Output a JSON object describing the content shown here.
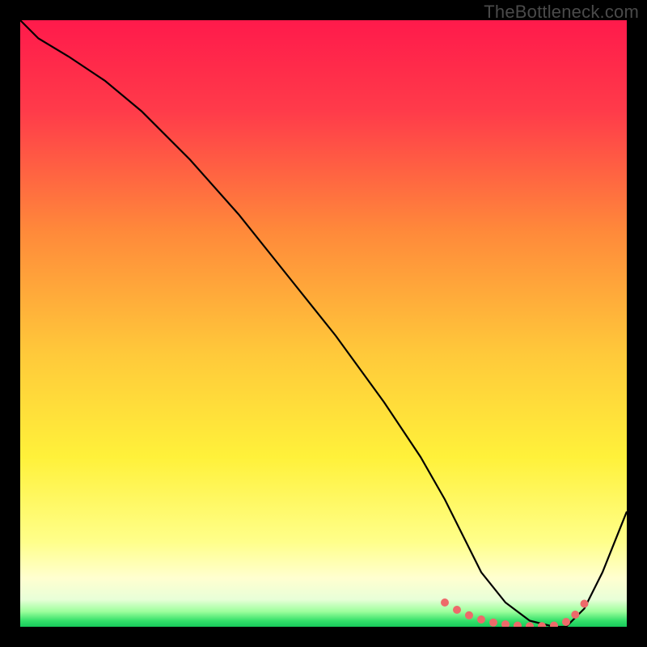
{
  "watermark": "TheBottleneck.com",
  "gradient": {
    "stops": [
      {
        "offset": 0.0,
        "color": "#ff1a4b"
      },
      {
        "offset": 0.15,
        "color": "#ff3b4a"
      },
      {
        "offset": 0.35,
        "color": "#ff8a3a"
      },
      {
        "offset": 0.55,
        "color": "#ffc93a"
      },
      {
        "offset": 0.72,
        "color": "#fff13a"
      },
      {
        "offset": 0.86,
        "color": "#ffff8a"
      },
      {
        "offset": 0.92,
        "color": "#ffffd0"
      },
      {
        "offset": 0.955,
        "color": "#e8ffd8"
      },
      {
        "offset": 0.975,
        "color": "#9cff9c"
      },
      {
        "offset": 0.99,
        "color": "#35e06a"
      },
      {
        "offset": 1.0,
        "color": "#17c95a"
      }
    ]
  },
  "chart_data": {
    "type": "line",
    "title": "",
    "xlabel": "",
    "ylabel": "",
    "xlim": [
      0,
      100
    ],
    "ylim": [
      0,
      100
    ],
    "series": [
      {
        "name": "curve",
        "x": [
          0,
          3,
          8,
          14,
          20,
          28,
          36,
          44,
          52,
          60,
          66,
          70,
          73,
          76,
          80,
          84,
          88,
          90,
          93,
          96,
          100
        ],
        "y": [
          100,
          97,
          94,
          90,
          85,
          77,
          68,
          58,
          48,
          37,
          28,
          21,
          15,
          9,
          4,
          1,
          0,
          0,
          3,
          9,
          19
        ]
      }
    ],
    "markers": {
      "name": "dotted-segment",
      "x": [
        70,
        72,
        74,
        76,
        78,
        80,
        82,
        84,
        86,
        88,
        90,
        91.5,
        93
      ],
      "y": [
        4,
        2.8,
        1.9,
        1.2,
        0.7,
        0.4,
        0.2,
        0.1,
        0.1,
        0.2,
        0.8,
        2.0,
        3.8
      ],
      "color": "#ed6a6a",
      "radius": 5
    }
  }
}
